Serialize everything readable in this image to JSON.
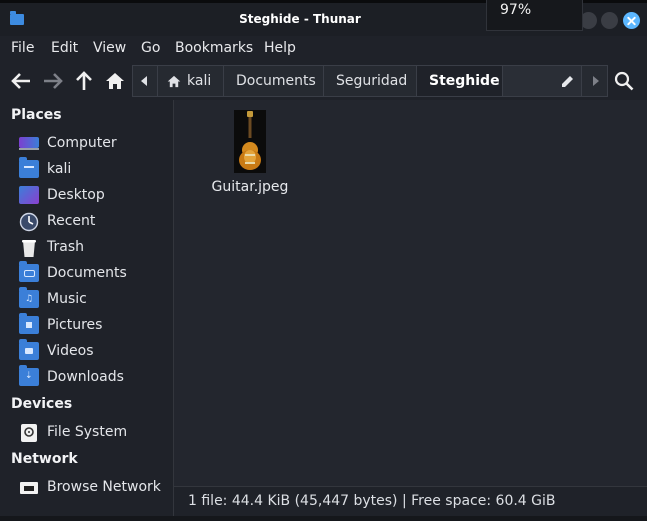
{
  "window": {
    "title": "Steghide - Thunar"
  },
  "osd": {
    "value": "97%"
  },
  "menu": [
    "File",
    "Edit",
    "View",
    "Go",
    "Bookmarks",
    "Help"
  ],
  "pathbar": {
    "segments": [
      "kali",
      "Documents",
      "Seguridad",
      "Steghide"
    ],
    "active": "Steghide"
  },
  "sidebar": {
    "places_title": "Places",
    "places": [
      "Computer",
      "kali",
      "Desktop",
      "Recent",
      "Trash",
      "Documents",
      "Music",
      "Pictures",
      "Videos",
      "Downloads"
    ],
    "devices_title": "Devices",
    "devices": [
      "File System"
    ],
    "network_title": "Network",
    "network": [
      "Browse Network"
    ]
  },
  "files": [
    {
      "name": "Guitar.jpeg",
      "icon": "guitar-image-thumbnail"
    }
  ],
  "status": {
    "text": "1 file: 44.4 KiB (45,447 bytes) | Free space: 60.4 GiB"
  },
  "colors": {
    "accent": "#3b7fd8",
    "close_button": "#5cb7ff",
    "background": "#1f2229"
  }
}
